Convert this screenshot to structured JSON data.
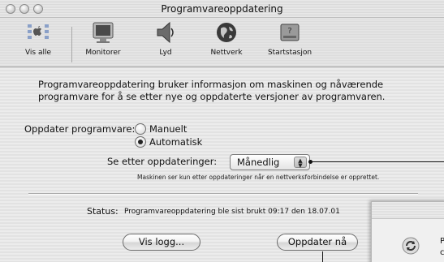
{
  "window": {
    "title": "Programvareoppdatering"
  },
  "toolbar": {
    "items": [
      {
        "label": "Vis alle",
        "icon": "apple-show-all-icon"
      },
      {
        "label": "Monitorer",
        "icon": "monitor-icon"
      },
      {
        "label": "Lyd",
        "icon": "speaker-icon"
      },
      {
        "label": "Nettverk",
        "icon": "globe-icon"
      },
      {
        "label": "Startstasjon",
        "icon": "startup-disk-icon"
      }
    ]
  },
  "main": {
    "description_line1": "Programvareoppdatering bruker informasjon om maskinen og nåværende",
    "description_line2": "programvare for å se etter nye og oppdaterte versjoner av programvaren.",
    "update_label": "Oppdater programvare:",
    "options": [
      {
        "label": "Manuelt",
        "selected": false
      },
      {
        "label": "Automatisk",
        "selected": true
      }
    ],
    "check_label": "Se etter oppdateringer:",
    "check_value": "Månedlig",
    "note": "Maskinen ser kun etter oppdateringer når en nettverksforbindelse er opprettet.",
    "status_label": "Status:",
    "status_text": "Programvareoppdatering ble sist brukt 09:17 den 18.07.01",
    "buttons": {
      "log": "Vis logg...",
      "update": "Oppdater nå"
    }
  },
  "dialog": {
    "text_line1": "P",
    "text_line2": "c"
  }
}
